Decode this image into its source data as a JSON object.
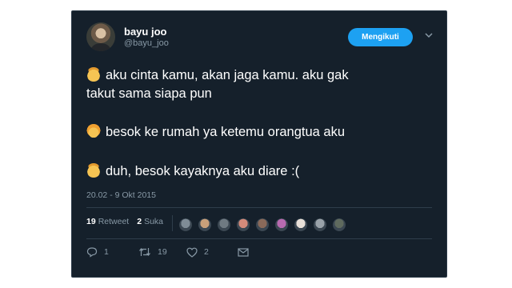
{
  "user": {
    "name": "bayu joo",
    "handle": "@bayu_joo"
  },
  "follow_label": "Mengikuti",
  "lines": [
    {
      "emoji": "boy-emoji",
      "text": "aku cinta kamu, akan jaga kamu. aku gak"
    },
    {
      "text": "takut sama siapa pun"
    },
    {
      "emoji": "girl-emoji",
      "text": "besok ke rumah ya ketemu orangtua aku"
    },
    {
      "emoji": "boy-emoji",
      "text": "duh, besok kayaknya aku diare :("
    }
  ],
  "timestamp": "20.02 - 9 Okt 2015",
  "stats": {
    "retweet_count": "19",
    "retweet_label": "Retweet",
    "like_count": "2",
    "like_label": "Suka"
  },
  "liker_colors": [
    "#7f8c96",
    "#c9a07a",
    "#6f7a82",
    "#d48a7a",
    "#8a6a5a",
    "#b86ab0",
    "#e8e0d8",
    "#9aa3aa",
    "#5f6a5e"
  ],
  "actions": {
    "reply": "1",
    "retweet": "19",
    "like": "2"
  },
  "colors": {
    "background": "#15202b",
    "accent": "#1da1f2",
    "muted": "#8899a6"
  }
}
